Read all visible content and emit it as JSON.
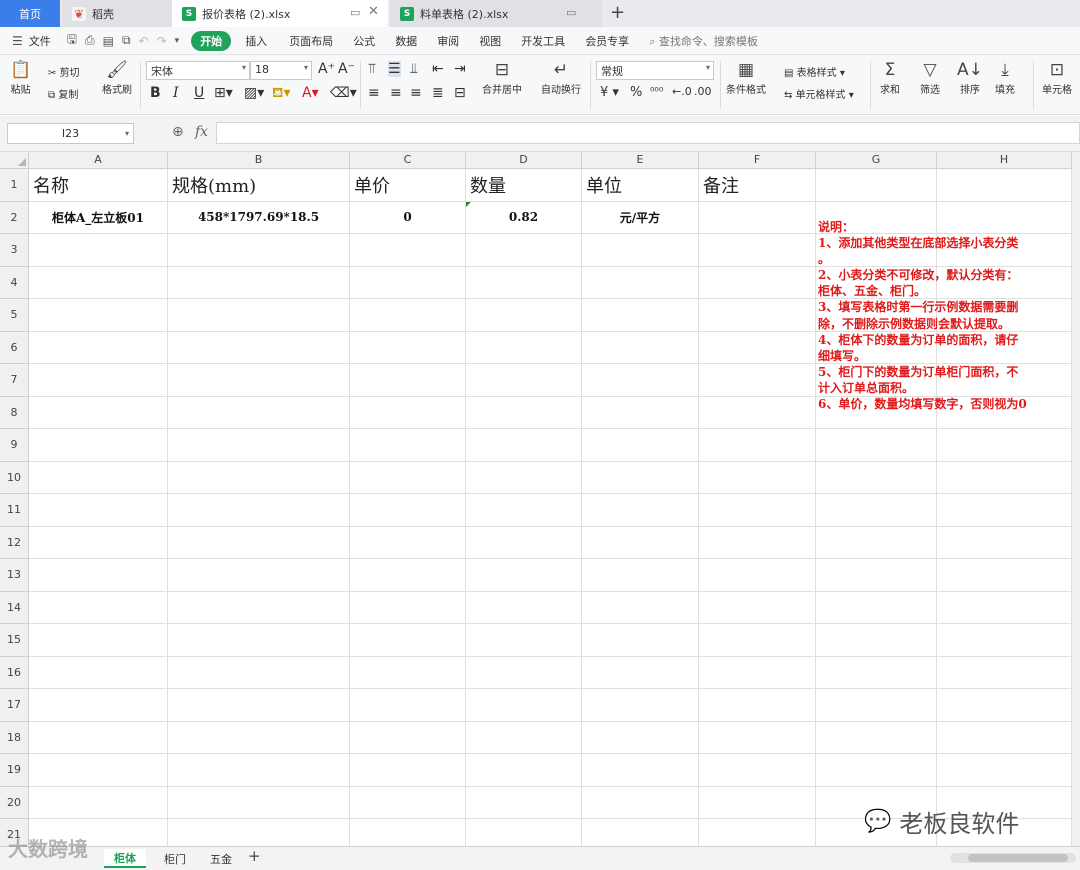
{
  "tabs": {
    "home": "首页",
    "docer": "稻壳",
    "file1": "报价表格 (2).xlsx",
    "file2": "料单表格 (2).xlsx",
    "add": "+"
  },
  "menu": {
    "file": "文件",
    "items": [
      "开始",
      "插入",
      "页面布局",
      "公式",
      "数据",
      "审阅",
      "视图",
      "开发工具",
      "会员专享"
    ],
    "search": "查找命令、搜索模板"
  },
  "ribbon": {
    "paste": "粘贴",
    "cut": "剪切",
    "copy": "复制",
    "format_painter": "格式刷",
    "font_name": "宋体",
    "font_size": "18",
    "bold": "B",
    "italic": "I",
    "underline": "U",
    "merge_center": "合并居中",
    "wrap_text": "自动换行",
    "number_format": "常规",
    "currency": "¥",
    "percent": "%",
    "table_style": "表格样式",
    "cond_format": "条件格式",
    "cell_style": "单元格样式",
    "sum": "求和",
    "filter": "筛选",
    "sort": "排序",
    "fill": "填充",
    "cell": "单元格"
  },
  "formula_bar": {
    "name_box": "I23",
    "fx": "fx",
    "value": ""
  },
  "sheet": {
    "columns": [
      "A",
      "B",
      "C",
      "D",
      "E",
      "F",
      "G",
      "H"
    ],
    "rows": [
      "1",
      "2",
      "3",
      "4",
      "5",
      "6",
      "7",
      "8",
      "9",
      "10",
      "11",
      "12",
      "13",
      "14",
      "15",
      "16",
      "17",
      "18",
      "19",
      "20",
      "21"
    ],
    "header_row": [
      "名称",
      "规格(mm)",
      "单价",
      "数量",
      "单位",
      "备注"
    ],
    "data_row": [
      "柜体A_左立板01",
      "458*1797.69*18.5",
      "0",
      "0.82",
      "元/平方",
      ""
    ],
    "note": "说明：\n1、添加其他类型在底部选择小表分类\n。\n2、小表分类不可修改，默认分类有：\n柜体、五金、柜门。\n3、填写表格时第一行示例数据需要删\n除，不删除示例数据则会默认提取。\n4、柜体下的数量为订单的面积，请仔\n细填写。\n5、柜门下的数量为订单柜门面积，不\n计入订单总面积。\n6、单价，数量均填写数字，否则视为0"
  },
  "sheet_tabs": [
    "柜体",
    "柜门",
    "五金"
  ],
  "watermark": {
    "brand": "老板良软件",
    "overlay": "大数跨境"
  }
}
